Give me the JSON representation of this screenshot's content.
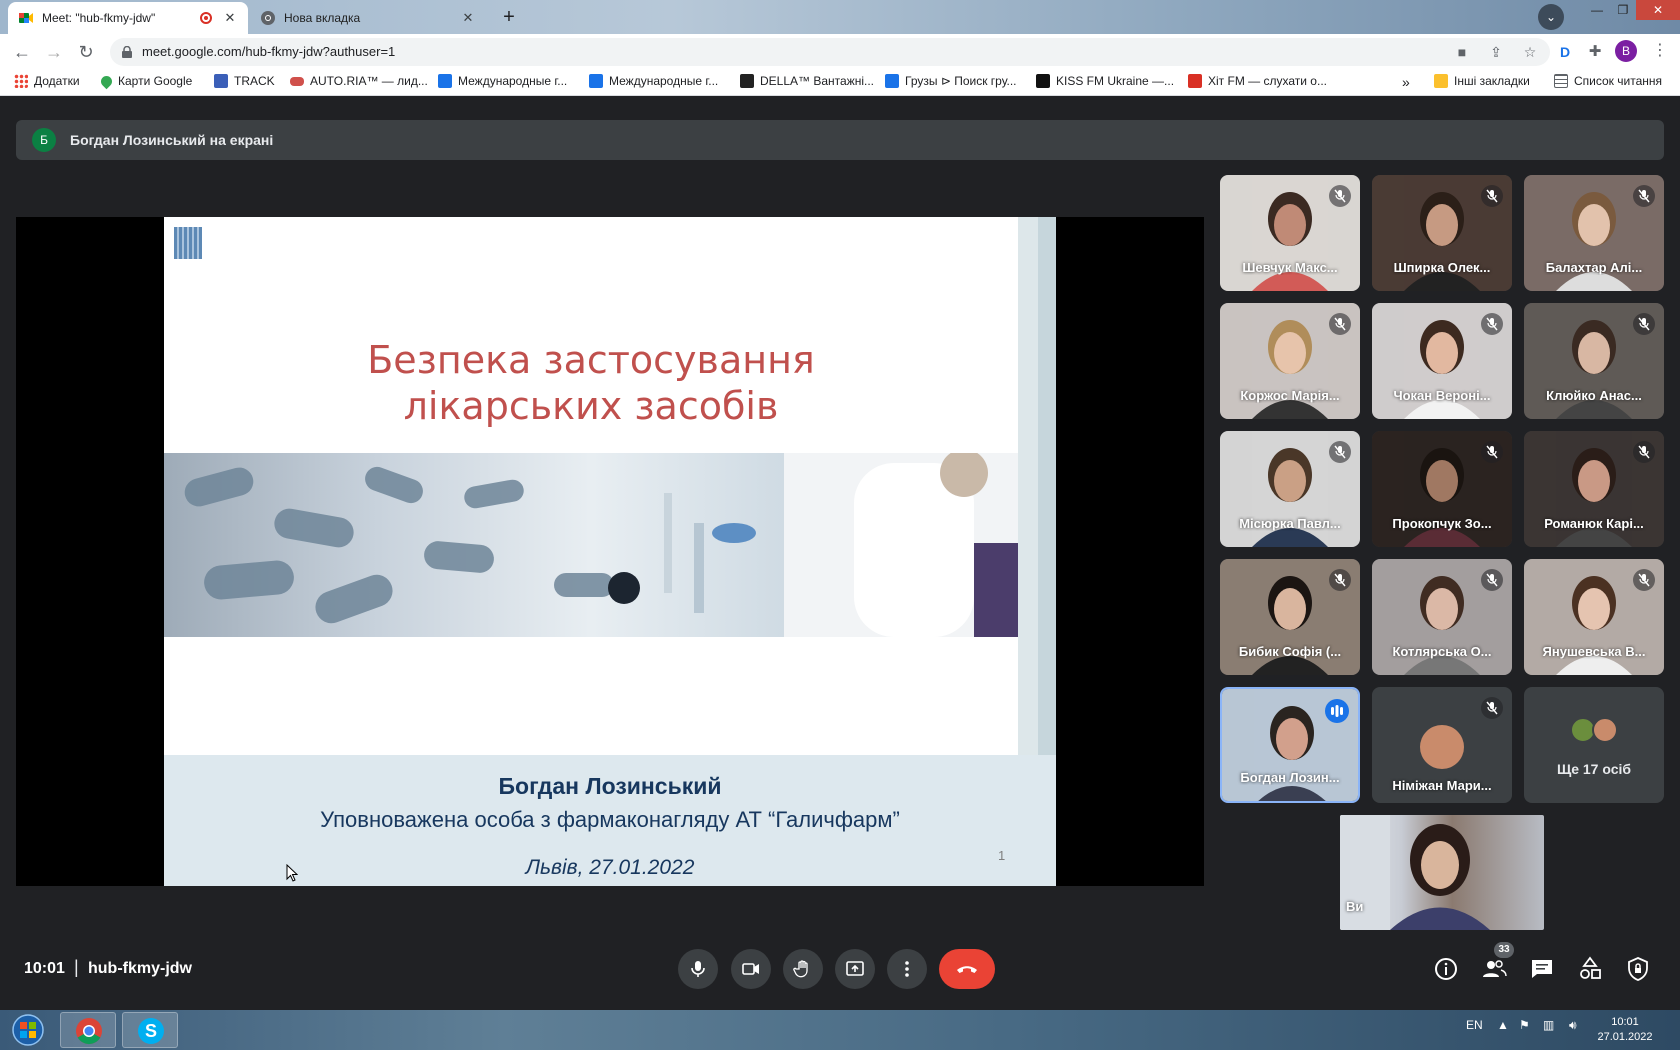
{
  "browser": {
    "tabs": [
      {
        "title": "Meet: \"hub-fkmy-jdw\"",
        "active": true,
        "recording": true
      },
      {
        "title": "Нова вкладка",
        "active": false
      }
    ],
    "url": "meet.google.com/hub-fkmy-jdw?authuser=1",
    "profile_initial": "B",
    "bookmarks": [
      {
        "label": "Додатки",
        "icon": "apps-grid-icon"
      },
      {
        "label": "Карти Google",
        "icon": "maps-pin-icon"
      },
      {
        "label": "TRACK",
        "icon": "track-icon"
      },
      {
        "label": "AUTO.RIA™ — лид...",
        "icon": "car-icon"
      },
      {
        "label": "Международные г...",
        "icon": "della-icon"
      },
      {
        "label": "Международные г...",
        "icon": "della-icon"
      },
      {
        "label": "DELLA™ Вантажні...",
        "icon": "della-d-icon"
      },
      {
        "label": "Грузы ⊳ Поиск гру...",
        "icon": "della-icon"
      },
      {
        "label": "KISS FM Ukraine —...",
        "icon": "kiss-fm-icon"
      },
      {
        "label": "Хіт FM — слухати о...",
        "icon": "hit-fm-icon"
      }
    ],
    "bookmarks_overflow": "»",
    "other_bookmarks": "Інші закладки",
    "reading_list": "Список читання"
  },
  "meet": {
    "presenter_initial": "Б",
    "presenting_text": "Богдан Лозинський на екрані",
    "slide": {
      "title_line1": "Безпека застосування",
      "title_line2": "лікарських засобів",
      "author": "Богдан Лозинський",
      "role": "Уповноважена особа з фармаконагляду  АТ “Галичфарм”",
      "place_date": "Львів, 27.01.2022",
      "page_number": "1"
    },
    "participants": [
      {
        "name": "Шевчук Макс...",
        "muted": true
      },
      {
        "name": "Шпирка Олек...",
        "muted": true
      },
      {
        "name": "Балахтар Алі...",
        "muted": true
      },
      {
        "name": "Коржос Марія...",
        "muted": true
      },
      {
        "name": "Чокан Вероні...",
        "muted": true
      },
      {
        "name": "Клюйко Анас...",
        "muted": true
      },
      {
        "name": "Місюрка Павл...",
        "muted": true
      },
      {
        "name": "Прокопчук Зо...",
        "muted": true
      },
      {
        "name": "Романюк Карі...",
        "muted": true
      },
      {
        "name": "Бибик Софія (...",
        "muted": true
      },
      {
        "name": "Котлярська О...",
        "muted": true
      },
      {
        "name": "Янушевська В...",
        "muted": true
      },
      {
        "name": "Богдан Лозин...",
        "muted": false,
        "speaking": true
      },
      {
        "name": "Німіжан Мари...",
        "muted": true
      }
    ],
    "more_participants": "Ще 17 осіб",
    "self_name": "Ви",
    "time": "10:01",
    "separator": "|",
    "meeting_code": "hub-fkmy-jdw",
    "people_count": "33",
    "colors": {
      "end_call": "#ea4335",
      "speaking": "#1a73e8",
      "presenter_avatar": "#0b8043"
    }
  },
  "taskbar": {
    "language": "EN",
    "time": "10:01",
    "date": "27.01.2022"
  }
}
